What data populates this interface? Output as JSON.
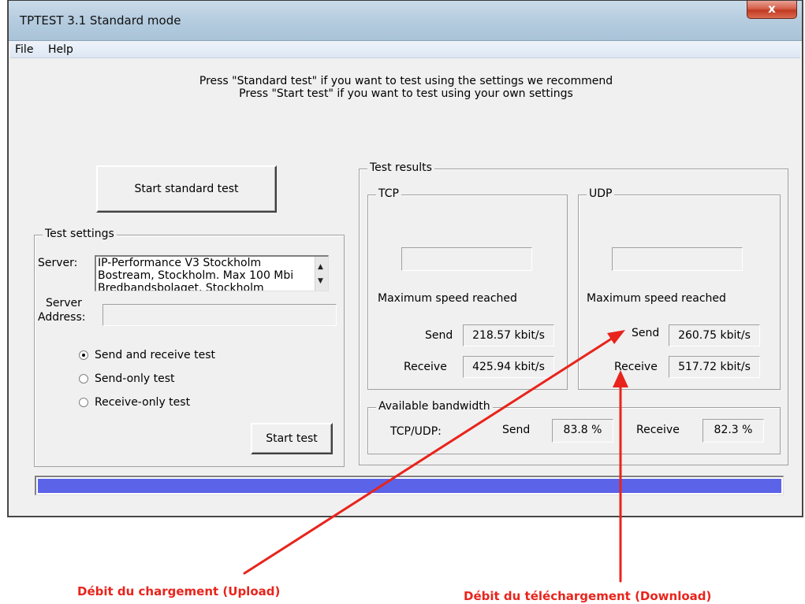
{
  "window": {
    "title": "TPTEST 3.1 Standard mode",
    "close_label": "x"
  },
  "menu": [
    "File",
    "Help"
  ],
  "instructions": {
    "line1": "Press \"Standard test\" if you want to test using the settings we recommend",
    "line2": "Press \"Start test\" if you want to test using your own settings"
  },
  "buttons": {
    "start_standard": "Start standard test",
    "start_test": "Start test"
  },
  "test_settings": {
    "label": "Test settings",
    "server_label": "Server:",
    "servers": [
      "IP-Performance V3 Stockholm",
      "Bostream, Stockholm. Max 100 Mbi",
      "Bredbandsbolaget, Stockholm"
    ],
    "server_address_label_1": "Server",
    "server_address_label_2": "Address:",
    "server_address_value": "",
    "radios": [
      {
        "label": "Send and receive test",
        "checked": true
      },
      {
        "label": "Send-only test",
        "checked": false
      },
      {
        "label": "Receive-only test",
        "checked": false
      }
    ]
  },
  "results": {
    "label": "Test results",
    "tcp": {
      "label": "TCP",
      "current": "",
      "max_label": "Maximum speed reached",
      "send_label": "Send",
      "send_value": "218.57 kbit/s",
      "receive_label": "Receive",
      "receive_value": "425.94 kbit/s"
    },
    "udp": {
      "label": "UDP",
      "current": "",
      "max_label": "Maximum speed reached",
      "send_label": "Send",
      "send_value": "260.75 kbit/s",
      "receive_label": "Receive",
      "receive_value": "517.72 kbit/s"
    },
    "bandwidth": {
      "label": "Available bandwidth",
      "proto_label": "TCP/UDP:",
      "send_label": "Send",
      "send_value": "83.8 %",
      "receive_label": "Receive",
      "receive_value": "82.3 %"
    }
  },
  "progress": {
    "percent": 100,
    "color": "#5b63e8"
  },
  "annotations": {
    "upload": "Débit du chargement (Upload)",
    "download": "Débit du téléchargement (Download)",
    "color": "#e8241c"
  }
}
